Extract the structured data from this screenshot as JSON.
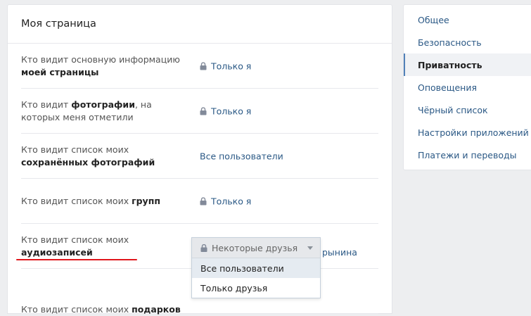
{
  "main": {
    "title": "Моя страница",
    "rows": [
      {
        "pre": "Кто видит основную информацию ",
        "bold": "моей страницы",
        "post": "",
        "value": "Только я",
        "lock": true
      },
      {
        "pre": "Кто видит ",
        "bold": "фотографии",
        "post": ", на которых меня отметили",
        "value": "Только я",
        "lock": true
      },
      {
        "pre": "Кто видит список моих ",
        "bold": "сохранённых фотографий",
        "post": "",
        "value": "Все пользователи",
        "lock": false
      },
      {
        "pre": "Кто видит список моих ",
        "bold": "групп",
        "post": "",
        "value": "Только я",
        "lock": true
      },
      {
        "pre": "Кто видит список моих ",
        "bold": "аудиозаписей",
        "post": "",
        "value": "",
        "lock": false
      },
      {
        "pre": "Кто видит список моих ",
        "bold": "подарков",
        "post": "",
        "value": "",
        "lock": false
      }
    ],
    "behind_text": "рынина"
  },
  "dropdown": {
    "selected": "Некоторые друзья",
    "options": [
      "Все пользователи",
      "Только друзья"
    ]
  },
  "sidebar": {
    "items": [
      {
        "label": "Общее"
      },
      {
        "label": "Безопасность"
      },
      {
        "label": "Приватность",
        "active": true
      },
      {
        "label": "Оповещения"
      },
      {
        "label": "Чёрный список"
      },
      {
        "label": "Настройки приложений"
      },
      {
        "label": "Платежи и переводы"
      }
    ]
  },
  "colors": {
    "accent": "#5181b8",
    "link": "#2a5885",
    "underline": "#e0161c"
  }
}
